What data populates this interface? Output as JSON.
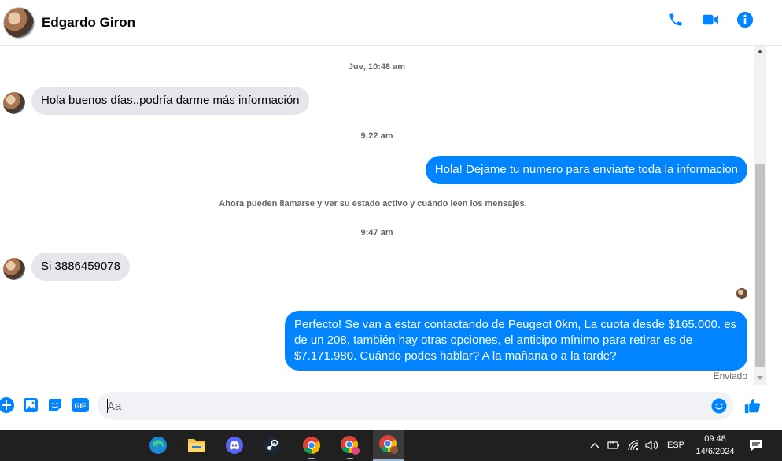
{
  "header": {
    "contact_name": "Edgardo Giron",
    "icons": [
      "phone-icon",
      "video-camera-icon",
      "info-icon"
    ],
    "accent_color": "#0084ff"
  },
  "conversation": {
    "timestamp_1": "Jue, 10:48 am",
    "msg_in_1": "Hola buenos días..podría darme más información",
    "timestamp_2": "9:22 am",
    "msg_out_1": "Hola! Dejame tu numero para enviarte toda la informacion",
    "system_notice": "Ahora pueden llamarse y ver su estado activo y cuándo leen los mensajes.",
    "timestamp_3": "9:47 am",
    "msg_in_2": "Si 3886459078",
    "msg_out_2": "Perfecto!  Se van a estar contactando de Peugeot 0km, La cuota desde $165.000. es de un 208, también hay otras opciones, el anticipo mínimo para retirar es de $7.171.980. Cuándo podes hablar? A la mañana o a la tarde?",
    "delivery_status": "Enviado",
    "incoming_bubble_color": "#e4e6eb",
    "outgoing_bubble_color": "#0084ff"
  },
  "composer": {
    "placeholder": "Aa",
    "icons": [
      "plus-icon",
      "image-icon",
      "sticker-icon",
      "gif-icon",
      "emoji-icon",
      "like-icon"
    ],
    "gif_label": "GIF"
  },
  "taskbar": {
    "apps": [
      "edge-icon",
      "file-explorer-icon",
      "discord-icon",
      "steam-icon",
      "chrome-icon",
      "chrome-profile-icon",
      "chrome-profile-active-icon"
    ],
    "language": "ESP",
    "time": "09:48",
    "date": "14/6/2024"
  }
}
